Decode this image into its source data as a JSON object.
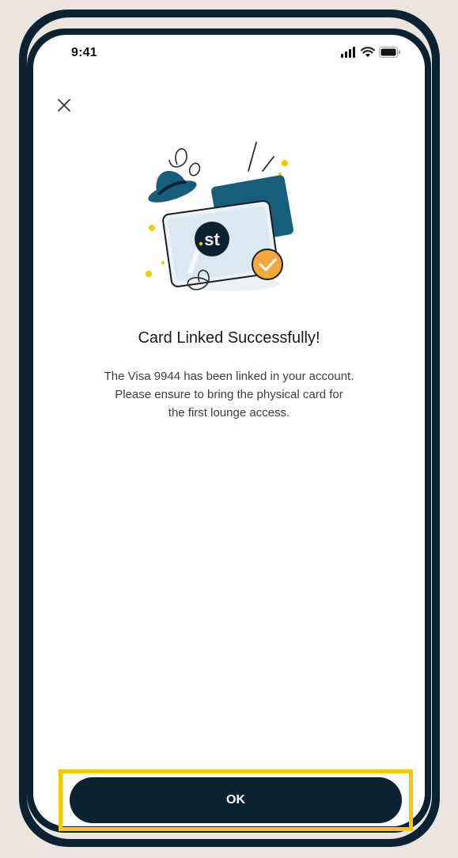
{
  "status_bar": {
    "time": "9:41"
  },
  "icons": {
    "close": "close-icon",
    "signal": "cellular-signal-icon",
    "wifi": "wifi-icon",
    "battery": "battery-icon"
  },
  "illustration": {
    "logo_text": "st"
  },
  "content": {
    "title": "Card Linked Successfully!",
    "description_lines": [
      "The Visa 9944 has been linked in your account.",
      "Please ensure to bring the physical card for",
      "the first lounge access."
    ]
  },
  "footer": {
    "ok_label": "OK"
  },
  "colors": {
    "background": "#ece5de",
    "device_frame": "#0b2233",
    "primary_button": "#0b2233",
    "highlight": "#f6c800",
    "accent_orange": "#f5a93c",
    "accent_blue": "#1a5a7a"
  }
}
